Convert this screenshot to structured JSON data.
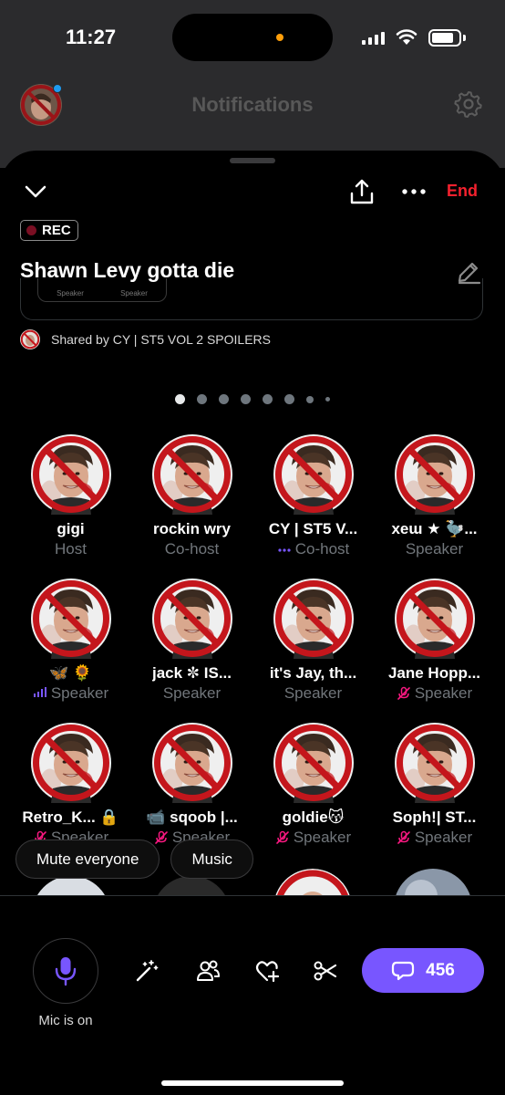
{
  "status_bar": {
    "time": "11:27"
  },
  "underlying": {
    "title": "Notifications"
  },
  "space": {
    "end_label": "End",
    "rec_label": "REC",
    "title": "Shawn Levy gotta die",
    "preview_labels": [
      "Speaker",
      "Speaker"
    ],
    "shared_by": "Shared by CY | ST5 VOL 2 SPOILERS",
    "pages": 8,
    "active_page": 0
  },
  "participants": [
    {
      "name": "gigi",
      "role": "Host",
      "indicator": "none"
    },
    {
      "name": "rockin wry",
      "role": "Co-host",
      "indicator": "none"
    },
    {
      "name": "CY | ST5 V...",
      "role": "Co-host",
      "indicator": "dots"
    },
    {
      "name": "xeɯ ★ 🦤...",
      "role": "Speaker",
      "indicator": "none"
    },
    {
      "name": "🦋 🌻",
      "role": "Speaker",
      "indicator": "talking"
    },
    {
      "name": "jack ✼ IS...",
      "role": "Speaker",
      "indicator": "none"
    },
    {
      "name": "it's Jay, th...",
      "role": "Speaker",
      "indicator": "none"
    },
    {
      "name": "Jane Hopp...",
      "role": "Speaker",
      "indicator": "muted"
    },
    {
      "name": "Retro_K... 🔒",
      "role": "Speaker",
      "indicator": "muted"
    },
    {
      "name": "📹 sqoob |...",
      "role": "Speaker",
      "indicator": "muted"
    },
    {
      "name": "goldie😽",
      "role": "Speaker",
      "indicator": "muted"
    },
    {
      "name": "Soph!| ST...",
      "role": "Speaker",
      "indicator": "muted"
    }
  ],
  "chips": {
    "mute_everyone": "Mute everyone",
    "music": "Music"
  },
  "bottom": {
    "mic_label": "Mic is on",
    "chat_count": "456"
  },
  "colors": {
    "accent": "#7856ff",
    "end": "#f4212e",
    "muted": "#f91880",
    "ban": "#c4161c"
  }
}
